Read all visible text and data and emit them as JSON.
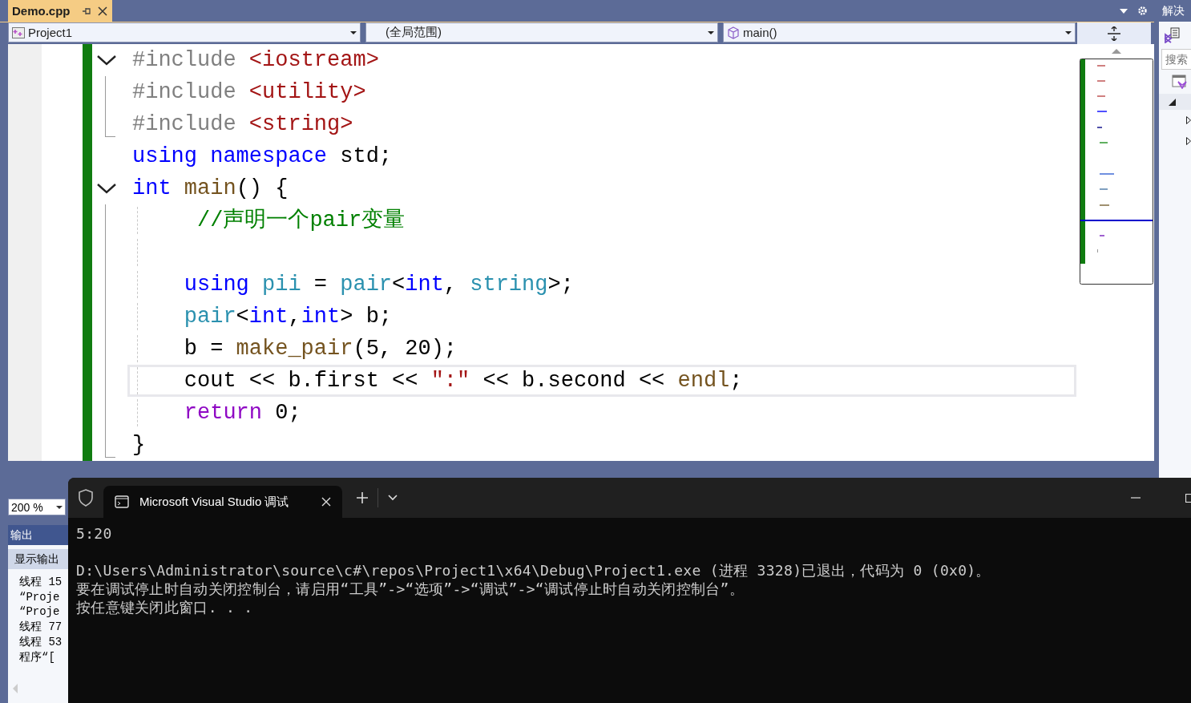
{
  "document_tab": {
    "title": "Demo.cpp",
    "selected": true
  },
  "navigation_bar": {
    "project": "Project1",
    "scope": "(全局范围)",
    "member": "main()"
  },
  "code_lines": [
    {
      "kind": "fold_start",
      "expanded": true,
      "current": false,
      "tokens": [
        {
          "kind": "preproc",
          "text": "#include "
        },
        {
          "kind": "string",
          "text": "<iostream>"
        }
      ]
    },
    {
      "kind": "fold_inner",
      "current": false,
      "tokens": [
        {
          "kind": "preproc",
          "text": "#include "
        },
        {
          "kind": "string",
          "text": "<utility>"
        }
      ]
    },
    {
      "kind": "fold_end",
      "current": false,
      "tokens": [
        {
          "kind": "preproc",
          "text": "#include "
        },
        {
          "kind": "string",
          "text": "<string>"
        }
      ]
    },
    {
      "kind": "plain",
      "current": false,
      "tokens": [
        {
          "kind": "keyword",
          "text": "using namespace"
        },
        {
          "kind": "plain",
          "text": " std;"
        }
      ]
    },
    {
      "kind": "fold_start",
      "expanded": true,
      "current": false,
      "tokens": [
        {
          "kind": "keyword",
          "text": "int"
        },
        {
          "kind": "function",
          "text": " main"
        },
        {
          "kind": "plain",
          "text": "() {"
        }
      ],
      "children": [
        {
          "kind": "fold_inner",
          "current": false,
          "tokens": [
            {
              "kind": "comment",
              "text": " //声明一个pair变量"
            }
          ]
        },
        {
          "kind": "fold_inner",
          "current": false
        },
        {
          "kind": "fold_inner",
          "current": false,
          "tokens": [
            {
              "kind": "keyword",
              "text": "using"
            },
            {
              "kind": "type",
              "text": " pii"
            },
            {
              "kind": "plain",
              "text": " = "
            },
            {
              "kind": "type",
              "text": "pair"
            },
            {
              "kind": "plain",
              "text": "<"
            },
            {
              "kind": "keyword",
              "text": "int"
            },
            {
              "kind": "plain",
              "text": ", "
            },
            {
              "kind": "type",
              "text": "string"
            },
            {
              "kind": "plain",
              "text": ">;"
            }
          ]
        },
        {
          "kind": "fold_inner",
          "current": false,
          "tokens": [
            {
              "kind": "type",
              "text": "pair"
            },
            {
              "kind": "plain",
              "text": "<"
            },
            {
              "kind": "keyword",
              "text": "int"
            },
            {
              "kind": "plain",
              "text": ","
            },
            {
              "kind": "keyword",
              "text": "int"
            },
            {
              "kind": "plain",
              "text": "> b;"
            }
          ]
        },
        {
          "kind": "fold_inner",
          "current": false,
          "tokens": [
            {
              "kind": "plain",
              "text": "b = "
            },
            {
              "kind": "function",
              "text": "make_pair"
            },
            {
              "kind": "plain",
              "text": "(5, 20);"
            }
          ]
        },
        {
          "kind": "fold_inner",
          "current": true,
          "tokens": [
            {
              "kind": "plain",
              "text": "cout << b.first << "
            },
            {
              "kind": "string",
              "text": "\":\""
            },
            {
              "kind": "plain",
              "text": " << b.second << "
            },
            {
              "kind": "function",
              "text": "endl"
            },
            {
              "kind": "plain",
              "text": ";"
            }
          ]
        },
        {
          "kind": "fold_inner",
          "current": false,
          "tokens": [
            {
              "kind": "control",
              "text": "return"
            },
            {
              "kind": "plain",
              "text": " 0;"
            }
          ]
        }
      ]
    },
    {
      "kind": "fold_end",
      "current": false,
      "tokens": [
        {
          "kind": "plain",
          "text": "}"
        }
      ]
    }
  ],
  "zoom": "200 %",
  "output_panel": {
    "title": "输出",
    "source_label": "显示输出",
    "lines": [
      "线程 15",
      "“Proje",
      "“Proje",
      "线程 77",
      "线程 53",
      "程序“["
    ]
  },
  "solution_explorer": {
    "title": "解决",
    "search_placeholder": "搜索"
  },
  "terminal": {
    "tab_title": "Microsoft Visual Studio 调试",
    "blocks": [
      [
        "5:20"
      ],
      [
        "D:\\Users\\Administrator\\source\\c#\\repos\\Project1\\x64\\Debug\\Project1.exe (进程 3328)已退出，代码为 0 (0x0)。",
        "要在调试停止时自动关闭控制台，请启用“工具”->“选项”->“调试”->“调试停止时自动关闭控制台”。",
        "按任意键关闭此窗口. . ."
      ]
    ]
  }
}
